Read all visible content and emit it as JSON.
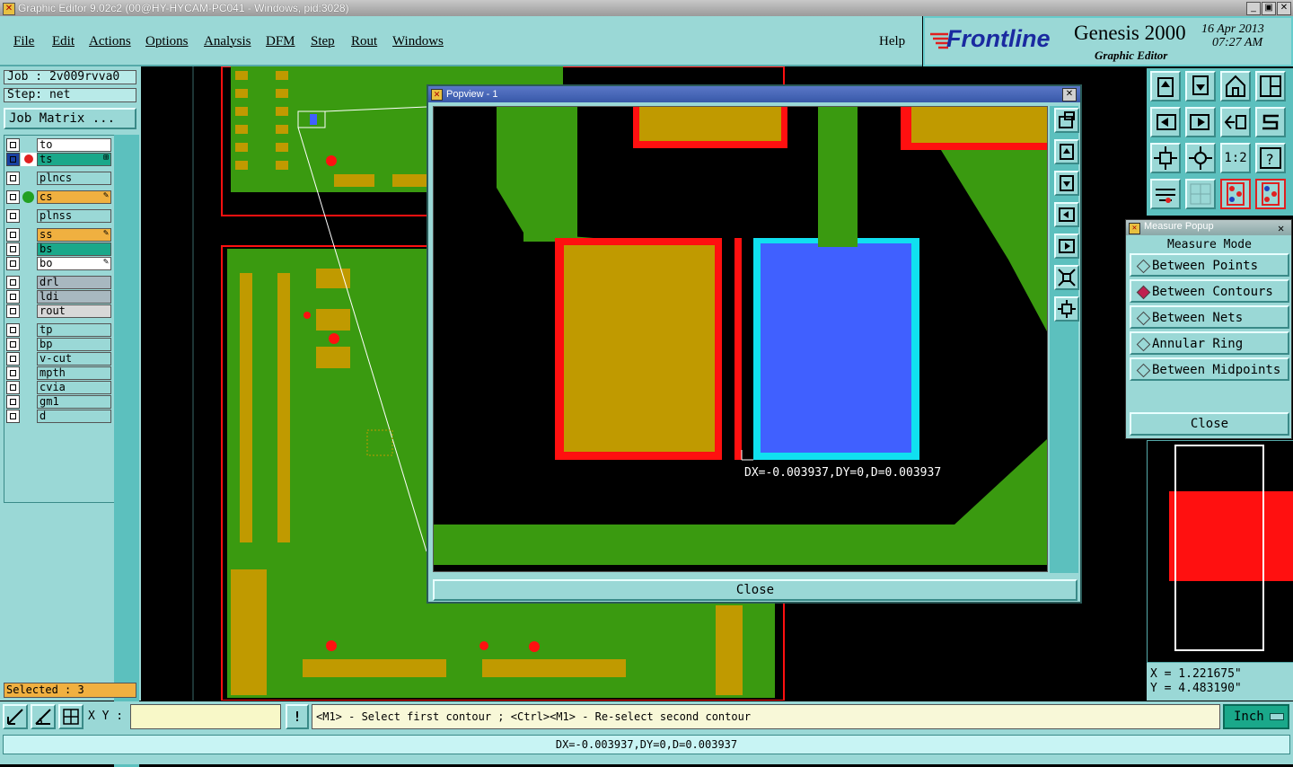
{
  "window": {
    "title": "Graphic Editor 9.02c2 (00@HY-HYCAM-PC041 - Windows, pid:3028)",
    "min_btn": "_",
    "max_btn": "▣",
    "close_btn": "✕"
  },
  "menu": [
    "File",
    "Edit",
    "Actions",
    "Options",
    "Analysis",
    "DFM",
    "Step",
    "Rout",
    "Windows"
  ],
  "help_label": "Help",
  "brand": {
    "logo_text": "Frontline",
    "product": "Genesis 2000",
    "subtitle": "Graphic Editor",
    "date": "16 Apr 2013",
    "time": "07:27 AM"
  },
  "job": {
    "job_line": "Job : 2v009rvva0",
    "step_line": "Step: net",
    "matrix_button": "Job Matrix ..."
  },
  "layers": [
    {
      "name": "to",
      "color": "#ffffff",
      "indicator": ""
    },
    {
      "name": "ts",
      "color": "#1aa88a",
      "indicator": "⊞"
    },
    {
      "name": "plncs",
      "color": "#9ad8d6",
      "indicator": ""
    },
    {
      "name": "cs",
      "color": "#f0b040",
      "indicator": "✎"
    },
    {
      "name": "plnss",
      "color": "#9ad8d6",
      "indicator": ""
    },
    {
      "name": "ss",
      "color": "#f0b040",
      "indicator": "✎"
    },
    {
      "name": "bs",
      "color": "#1aa88a",
      "indicator": ""
    },
    {
      "name": "bo",
      "color": "#ffffff",
      "indicator": "✎"
    },
    {
      "name": "drl",
      "color": "#a8b8c0",
      "indicator": ""
    },
    {
      "name": "ldi",
      "color": "#a8b8c0",
      "indicator": ""
    },
    {
      "name": "rout",
      "color": "#d8d8d8",
      "indicator": ""
    },
    {
      "name": "tp",
      "color": "#9ad8d6",
      "indicator": ""
    },
    {
      "name": "bp",
      "color": "#9ad8d6",
      "indicator": ""
    },
    {
      "name": "v-cut",
      "color": "#9ad8d6",
      "indicator": ""
    },
    {
      "name": "mpth",
      "color": "#9ad8d6",
      "indicator": ""
    },
    {
      "name": "cvia",
      "color": "#9ad8d6",
      "indicator": ""
    },
    {
      "name": "gm1",
      "color": "#9ad8d6",
      "indicator": ""
    },
    {
      "name": "d",
      "color": "#9ad8d6",
      "indicator": ""
    }
  ],
  "selected_label": "Selected : 3",
  "popview": {
    "title": "Popview - 1",
    "measure_text": "DX=-0.003937,DY=0,D=0.003937",
    "close_label": "Close"
  },
  "measure_popup": {
    "title": "Measure Popup",
    "header": "Measure Mode",
    "options": [
      "Between Points",
      "Between Contours",
      "Between Nets",
      "Annular Ring",
      "Between Midpoints"
    ],
    "selected": "Between Contours",
    "close_label": "Close"
  },
  "coords": {
    "x": "X = 1.221675\"",
    "y": "Y = 4.483190\""
  },
  "bottom": {
    "xy_label": "X Y :",
    "xy_value": "",
    "alert": "!",
    "prompt": "<M1> - Select first contour ; <Ctrl><M1> - Re-select second contour",
    "units": "Inch",
    "status": "DX=-0.003937,DY=0,D=0.003937"
  },
  "colors": {
    "panel": "#9ad8d6",
    "pcb_green": "#3a9a10",
    "pad_gold": "#c09a00",
    "highlight_red": "#ff1010",
    "select_cyan": "#10e0f0",
    "select_blue": "#4060ff"
  }
}
